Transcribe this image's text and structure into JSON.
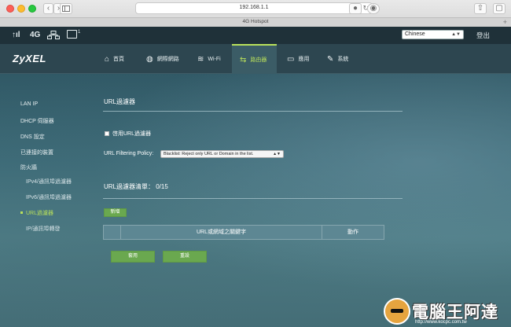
{
  "browser": {
    "url": "192.168.1.1",
    "tab_title": "4G Hotspot",
    "back_icon": "chevron-left",
    "forward_icon": "chevron-right",
    "new_tab_label": "+"
  },
  "status": {
    "signal": "↑ıl",
    "network": "4G",
    "sim_count": "1",
    "language": "Chinese",
    "logout": "登出"
  },
  "nav": {
    "logo": "ZyXEL",
    "items": [
      {
        "label": "首頁",
        "icon": "home-icon"
      },
      {
        "label": "網際網路",
        "icon": "globe-icon"
      },
      {
        "label": "Wi-Fi",
        "icon": "wifi-icon"
      },
      {
        "label": "路由器",
        "icon": "router-icon",
        "active": true
      },
      {
        "label": "應用",
        "icon": "monitor-icon"
      },
      {
        "label": "系統",
        "icon": "wrench-icon"
      }
    ]
  },
  "sidebar": {
    "items": [
      {
        "label": "LAN IP"
      },
      {
        "label": "DHCP 伺服器"
      },
      {
        "label": "DNS 設定"
      },
      {
        "label": "已連接的裝置"
      },
      {
        "label": "防火牆"
      },
      {
        "label": "IPv4/通訊埠過濾器"
      },
      {
        "label": "IPv6/通訊埠過濾器"
      },
      {
        "label": "URL過濾器",
        "active": true
      },
      {
        "label": "IP/通訊埠轉發"
      }
    ]
  },
  "main": {
    "title": "URL過濾器",
    "enable_label": "啓用URL過濾器",
    "policy_label": "URL Filtering Policy:",
    "policy_value": "Blacklist: Reject only URL or Domain in the list.",
    "list_title": "URL過濾器清單： 0/15",
    "add_label": "新增",
    "columns": [
      "URL或網域之關鍵字",
      "動作"
    ],
    "apply_label": "套用",
    "reset_label": "重設"
  },
  "watermark": {
    "text": "電腦王阿達",
    "url": "http://www.kocpc.com.tw"
  },
  "colors": {
    "accent": "#b9e05b",
    "button": "#6aa84f"
  }
}
